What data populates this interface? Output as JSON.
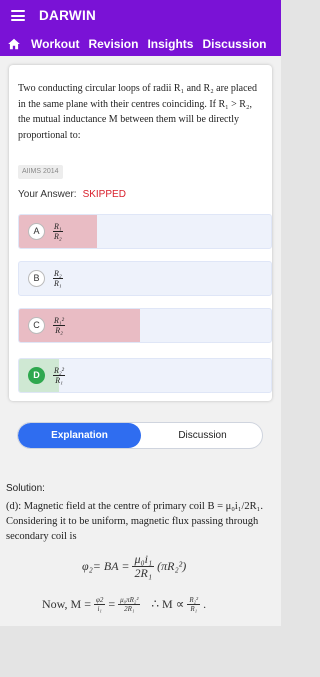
{
  "header": {
    "app_title": "DARWIN",
    "icons": [
      "hamburger-menu-icon",
      "home-icon"
    ],
    "nav_items": [
      "Workout",
      "Revision",
      "Insights",
      "Discussion"
    ]
  },
  "question": {
    "text": "Two conducting circular loops of radii R₁ and R₂ are placed in the same plane with their centres coinciding. If R₁ > R₂, the mutual inductance M between them will be directly proportional to:",
    "tag": "AIIMS 2014",
    "answer_label": "Your Answer:",
    "answer_value": "SKIPPED",
    "options": [
      {
        "letter": "A",
        "num": "R₁",
        "den": "R₂",
        "response_fraction": 0.31,
        "fill_color": "#e9bcc4",
        "correct": false
      },
      {
        "letter": "B",
        "num": "R₂",
        "den": "R₁",
        "response_fraction": 0.0,
        "fill_color": "#e9bcc4",
        "correct": false
      },
      {
        "letter": "C",
        "num": "R₁²",
        "den": "R₂",
        "response_fraction": 0.48,
        "fill_color": "#e9bcc4",
        "correct": false
      },
      {
        "letter": "D",
        "num": "R₂²",
        "den": "R₁",
        "response_fraction": 0.16,
        "fill_color": "#cfe8d3",
        "correct": true
      }
    ]
  },
  "tabs": {
    "explanation": "Explanation",
    "discussion": "Discussion",
    "active": "explanation"
  },
  "solution": {
    "title": "Solution:",
    "body": "(d): Magnetic field at the centre of primary coil B = μ₀i₁/2R₁. Considering it to be uniform, magnetic flux passing through secondary coil is",
    "eq1": {
      "lhs": "φ₂= BA =",
      "frac_num": "μ₀i₁",
      "frac_den": "2R₁",
      "rhs": "(πR₂²)"
    },
    "eq2": {
      "lead": "Now,   M =",
      "frac1_num": "φ2",
      "frac1_den": "i₁",
      "eq": "=",
      "frac2_num": "μ₀πR₂²",
      "frac2_den": "2R₁",
      "therefore": "∴ M ∝",
      "frac3_num": "R₂²",
      "frac3_den": "R₁",
      "tail": "."
    }
  },
  "colors": {
    "brand": "#7a12d6",
    "active_tab": "#2f6df0",
    "skipped": "#d9202c",
    "correct": "#2fa84f",
    "wrong_fill": "#e9bcc4",
    "correct_fill": "#cfe8d3"
  }
}
